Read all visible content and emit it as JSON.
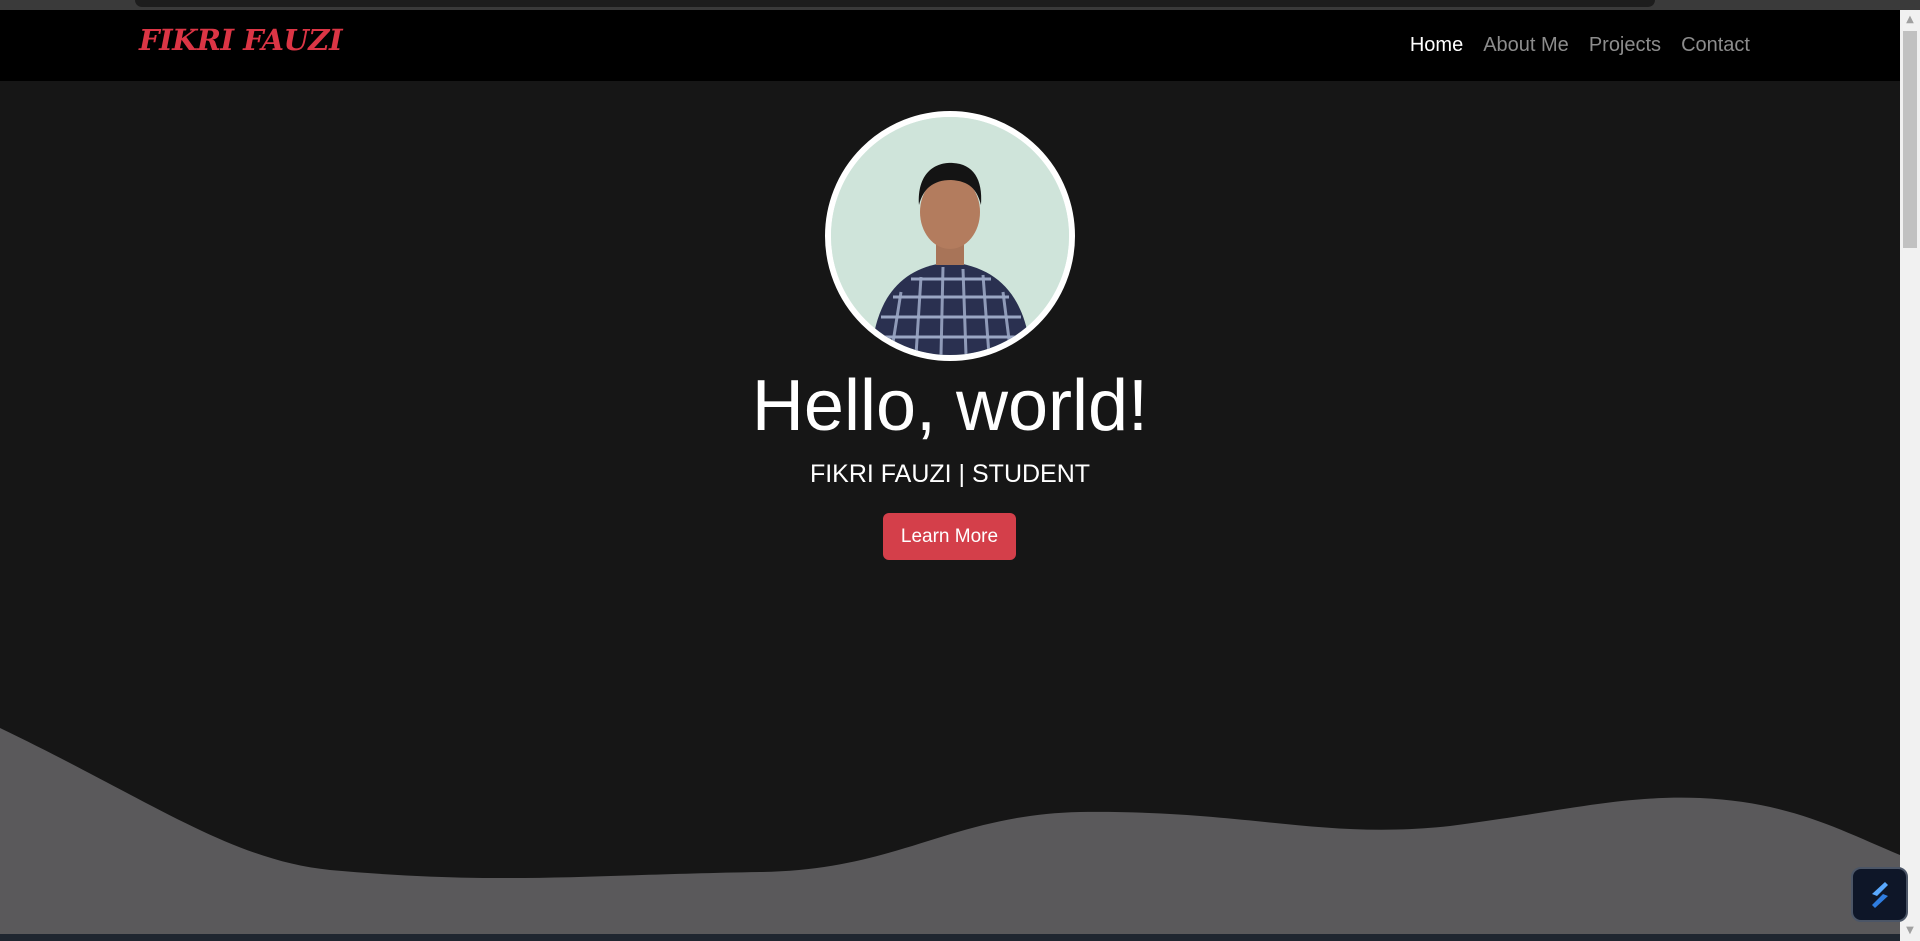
{
  "brand": "FIKRI FAUZI",
  "nav": {
    "items": [
      {
        "label": "Home",
        "active": true
      },
      {
        "label": "About Me",
        "active": false
      },
      {
        "label": "Projects",
        "active": false
      },
      {
        "label": "Contact",
        "active": false
      }
    ]
  },
  "hero": {
    "heading": "Hello, world!",
    "subtitle": "FIKRI FAUZI | STUDENT",
    "button_label": "Learn More",
    "avatar_icon": "profile-photo"
  },
  "colors": {
    "brand": "#dc3545",
    "navbar_bg": "#000000",
    "hero_bg": "#161616",
    "wave": "#5a595b",
    "button": "#d43f4a"
  },
  "widget": {
    "icon": "lightning-logo-icon"
  }
}
